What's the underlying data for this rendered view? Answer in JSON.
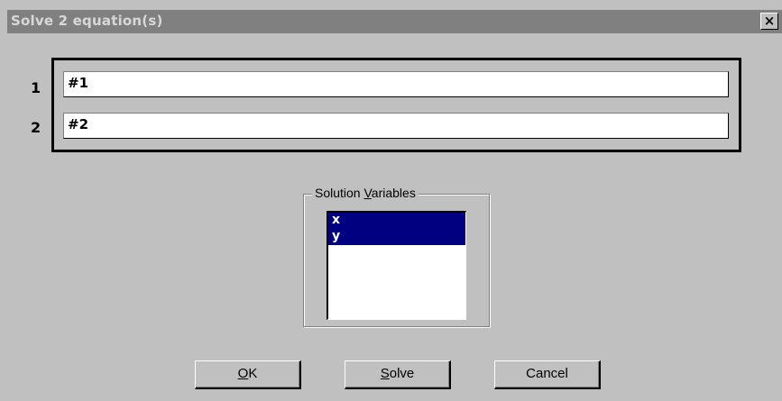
{
  "window": {
    "title": "Solve 2 equation(s)",
    "close_glyph": "×"
  },
  "equations": [
    {
      "number": "1",
      "value": "#1"
    },
    {
      "number": "2",
      "value": "#2"
    }
  ],
  "solution_variables": {
    "label_prefix": "Solution ",
    "label_hotkey": "V",
    "label_suffix": "ariables",
    "items": [
      "x",
      "y"
    ]
  },
  "buttons": {
    "ok": {
      "hotkey": "O",
      "rest": "K"
    },
    "solve": {
      "hotkey": "S",
      "rest": "olve"
    },
    "cancel": {
      "label": "Cancel"
    }
  },
  "colors": {
    "face": "#c0c0c0",
    "titlebar_inactive": "#808080",
    "selection": "#000080"
  }
}
